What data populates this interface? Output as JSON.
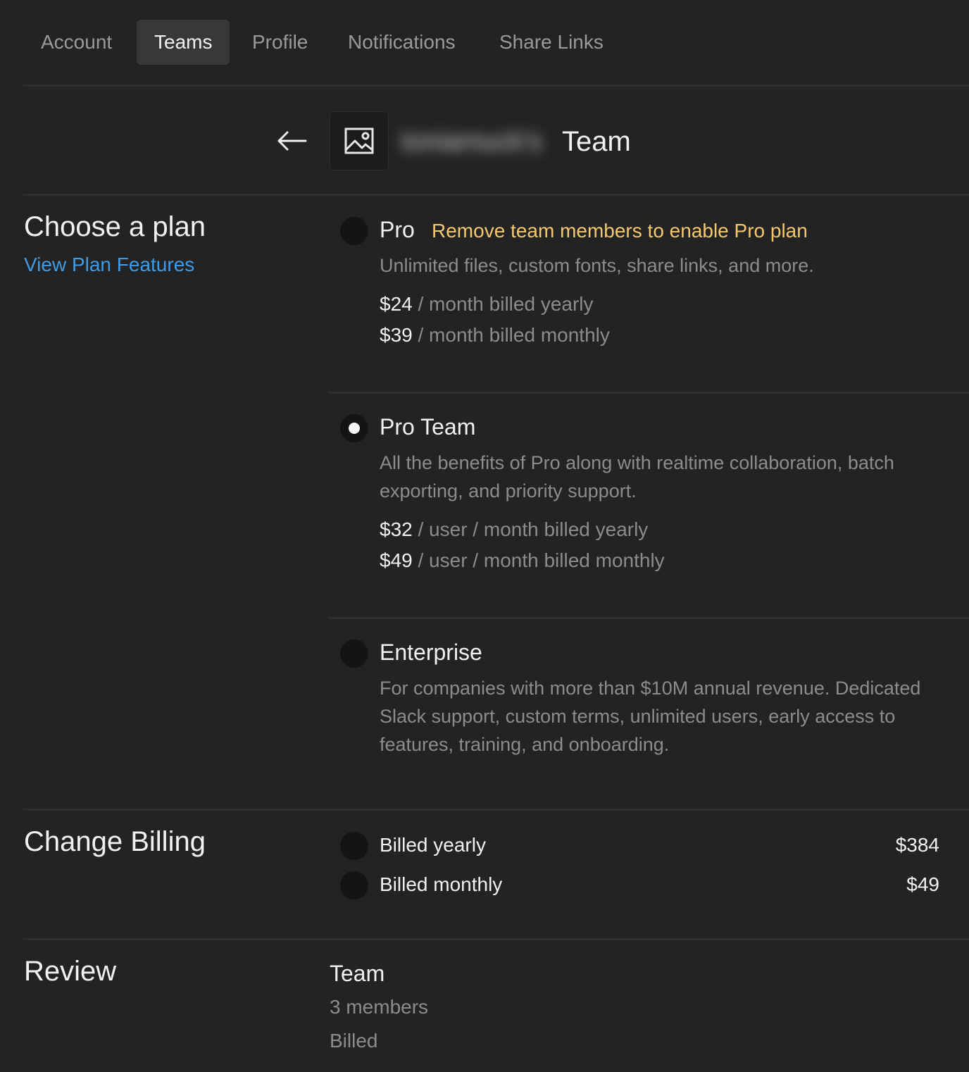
{
  "tabs": [
    {
      "label": "Account"
    },
    {
      "label": "Teams"
    },
    {
      "label": "Profile"
    },
    {
      "label": "Notifications"
    },
    {
      "label": "Share Links"
    }
  ],
  "active_tab": "Teams",
  "header": {
    "team_owner_redacted": "toniamuck's",
    "team_label": "Team"
  },
  "plan_section": {
    "title": "Choose a plan",
    "features_link": "View Plan Features",
    "plans": [
      {
        "name": "Pro",
        "warning": "Remove team members to enable Pro plan",
        "description": "Unlimited files, custom fonts, share links, and more.",
        "prices": [
          {
            "amount": "$24",
            "suffix": " / month billed yearly"
          },
          {
            "amount": "$39",
            "suffix": " / month billed monthly"
          }
        ],
        "selected": false
      },
      {
        "name": "Pro Team",
        "description": "All the benefits of Pro along with realtime collaboration, batch exporting, and priority support.",
        "prices": [
          {
            "amount": "$32",
            "suffix": " / user / month billed yearly"
          },
          {
            "amount": "$49",
            "suffix": " / user / month billed monthly"
          }
        ],
        "selected": true
      },
      {
        "name": "Enterprise",
        "description": "For companies with more than $10M annual revenue. Dedicated Slack support, custom terms, unlimited users, early access to features, training, and onboarding.",
        "selected": false
      }
    ]
  },
  "billing_section": {
    "title": "Change Billing",
    "options": [
      {
        "label": "Billed yearly",
        "amount": "$384",
        "selected": false
      },
      {
        "label": "Billed monthly",
        "amount": "$49",
        "selected": false
      }
    ]
  },
  "review_section": {
    "title": "Review",
    "heading": "Team",
    "members": "3 members",
    "billed": "Billed"
  },
  "colors": {
    "background": "#232323",
    "active_tab": "#383838",
    "link": "#3f9be6",
    "warning": "#f3c871",
    "muted_text": "#8c8c8c"
  }
}
